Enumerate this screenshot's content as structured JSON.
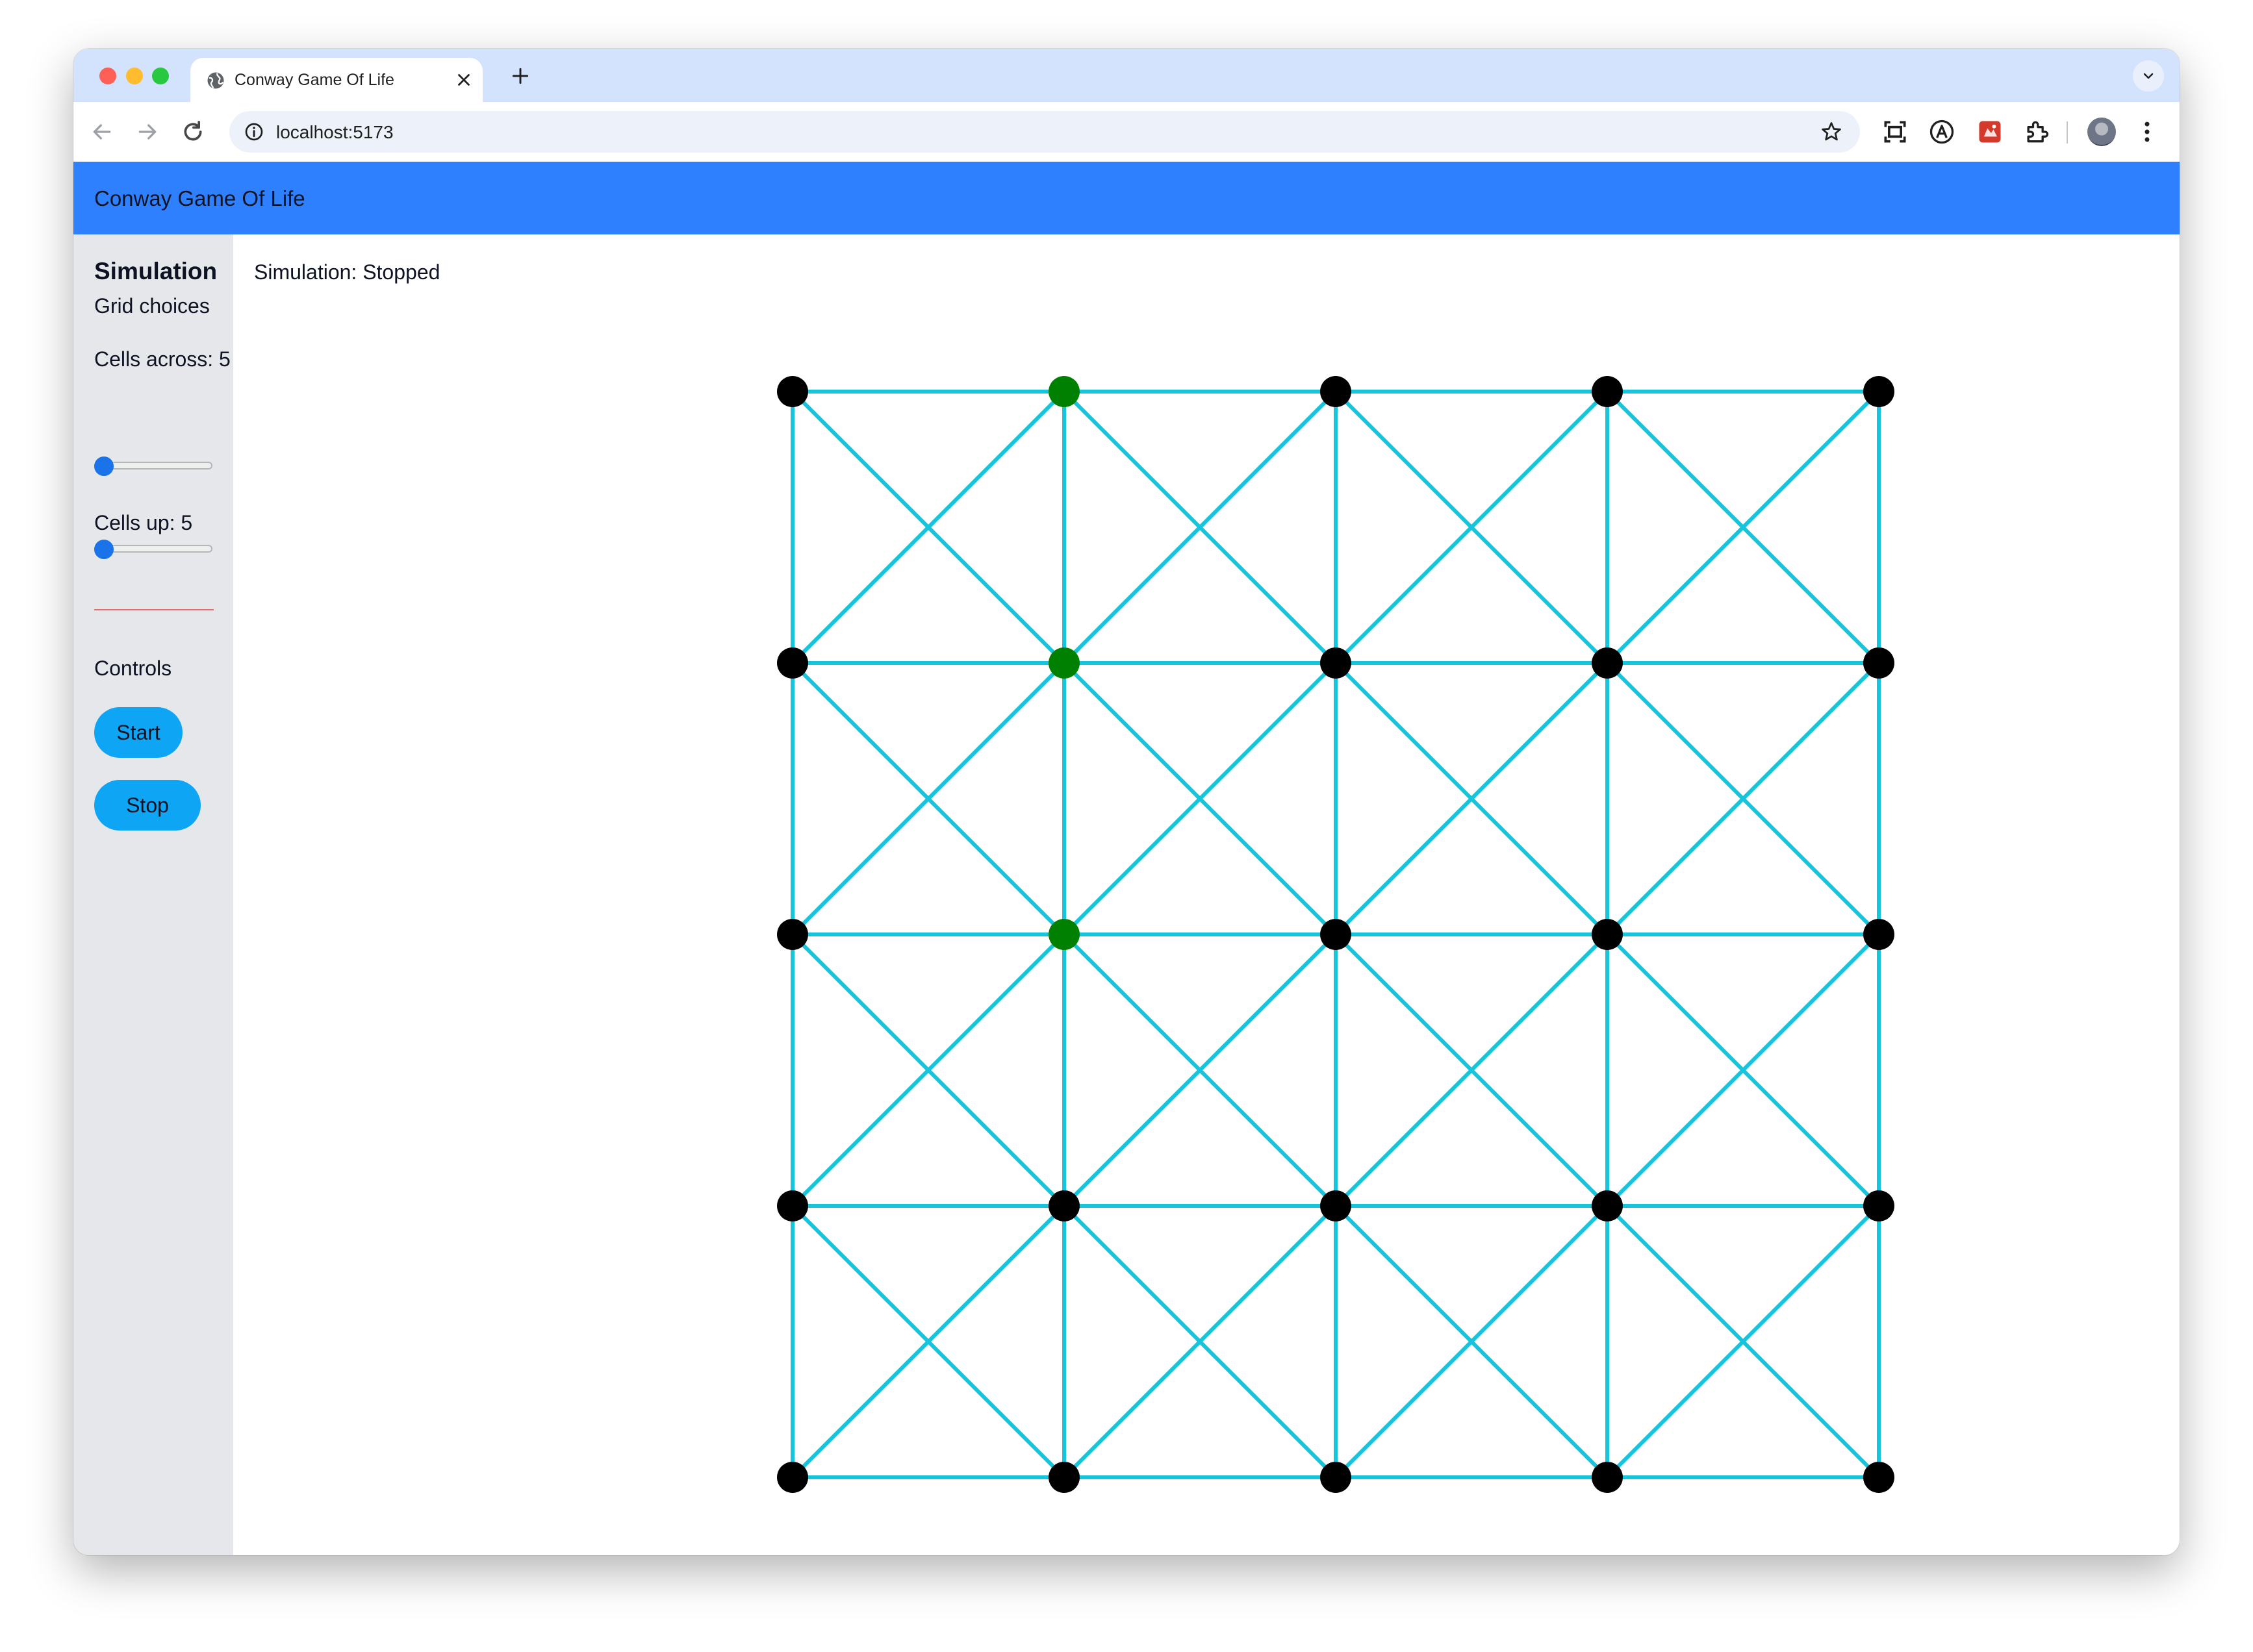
{
  "browser": {
    "tab_title": "Conway Game Of Life",
    "url": "localhost:5173"
  },
  "app": {
    "title": "Conway Game Of Life"
  },
  "sidebar": {
    "heading": "Simulation",
    "grid_choices": "Grid choices",
    "cells_across_label": "Cells across: 5",
    "cells_across_value": 5,
    "cells_up_label": "Cells up: 5",
    "cells_up_value": 5,
    "controls_label": "Controls",
    "start_label": "Start",
    "stop_label": "Stop"
  },
  "main": {
    "simulation_status": "Simulation: Stopped",
    "grid": {
      "cols": 5,
      "rows": 5,
      "line_color": "#16c4dc",
      "dead_color": "#000000",
      "alive_color": "#008000",
      "alive_cells": [
        [
          0,
          1
        ],
        [
          1,
          1
        ],
        [
          2,
          1
        ]
      ]
    }
  },
  "colors": {
    "header": "#2f80ff",
    "sidebar": "#e5e7eb",
    "button": "#0ea5f5",
    "divider": "#e96a6a"
  }
}
